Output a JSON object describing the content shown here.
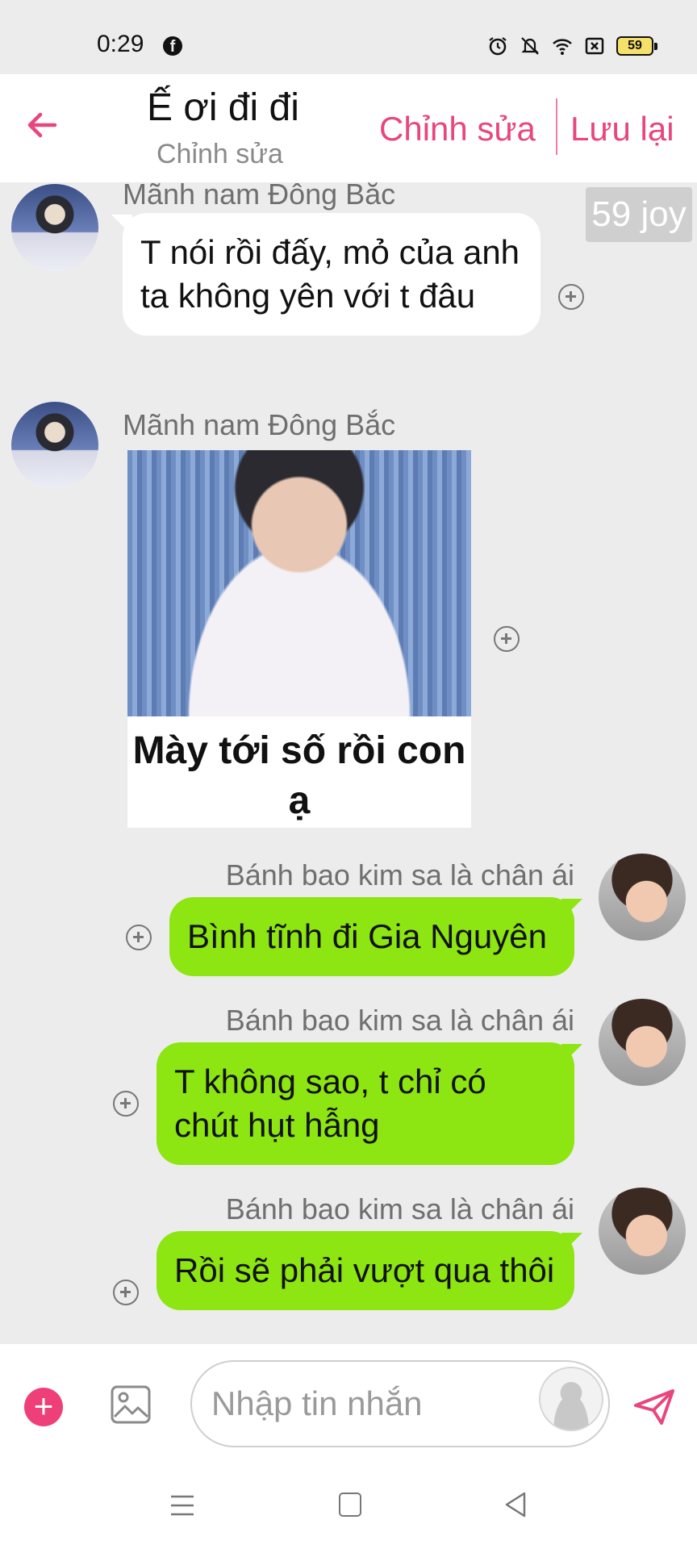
{
  "status_bar": {
    "time": "0:29",
    "battery": "59"
  },
  "header": {
    "title": "Ế ơi đi đi",
    "subtitle": "Chỉnh sửa",
    "edit_label": "Chỉnh sửa",
    "save_label": "Lưu lại",
    "accent_color": "#e8467c"
  },
  "joy_badge": "59 joy",
  "messages": [
    {
      "sender": "Mãnh nam Đông Bắc",
      "text": "T nói rồi đấy, mỏ của anh ta không yên với t đâu",
      "direction": "in"
    },
    {
      "sender": "Mãnh nam Đông Bắc",
      "image_caption": "Mày tới số rồi con ạ",
      "direction": "in"
    },
    {
      "sender": "Bánh bao kim sa là chân ái",
      "text": "Bình tĩnh đi Gia Nguyên",
      "direction": "out"
    },
    {
      "sender": "Bánh bao kim sa là chân ái",
      "text": "T không sao, t chỉ có chút hụt hẫng",
      "direction": "out"
    },
    {
      "sender": "Bánh bao kim sa là chân ái",
      "text": "Rồi sẽ phải vượt qua thôi",
      "direction": "out"
    }
  ],
  "input": {
    "placeholder": "Nhập tin nhắn"
  },
  "colors": {
    "outgoing_bubble": "#8de511",
    "incoming_bubble": "#ffffff",
    "background": "#ececec",
    "add_button": "#ee3f78"
  }
}
